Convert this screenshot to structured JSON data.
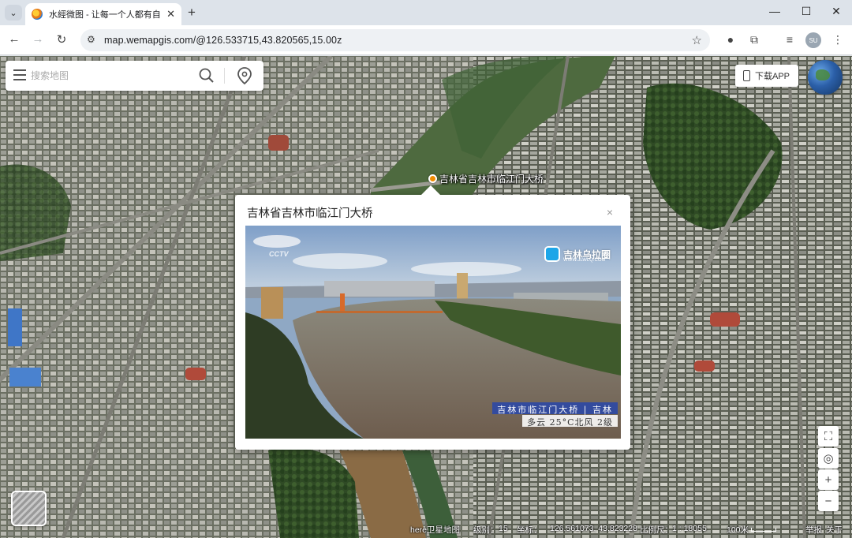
{
  "browser": {
    "tab_title": "水經微图 - 让每一个人都有自己",
    "url": "map.wemapgis.com/@126.533715,43.820565,15.00z",
    "profile_initials": "SU"
  },
  "search": {
    "placeholder": "搜索地图"
  },
  "app_button": {
    "label": "下载APP"
  },
  "marker": {
    "label": "吉林省吉林市临江门大桥",
    "color": "#f08c00"
  },
  "popup": {
    "title": "吉林省吉林市临江门大桥",
    "close_symbol": "×",
    "photo": {
      "watermark_logo": "吉林乌拉圈",
      "watermark_url": "WWW.JLWLQ.COM",
      "corner_mark": "CCTV",
      "caption_line1": "吉林市临江门大桥 | 吉林",
      "caption_line2": "多云  25°C北风  2级"
    }
  },
  "map_controls": {
    "zoom_in": "+",
    "zoom_out": "−"
  },
  "status": {
    "provider": "here卫星地图",
    "level_label": "级别：",
    "level_value": "15",
    "coord_label": "坐标：",
    "coord_value": "126.561073, 43.823228",
    "scale_label": "比例尺：",
    "scale_value": "1 : 18055",
    "distance": "100米",
    "report_link": "举报",
    "about_link": "关于"
  },
  "icons": [
    "menu-icon",
    "search-icon",
    "location-pin-icon",
    "phone-icon",
    "globe-icon",
    "screenshot-icon",
    "locate-icon",
    "close-icon",
    "star-icon",
    "extensions-icon"
  ]
}
